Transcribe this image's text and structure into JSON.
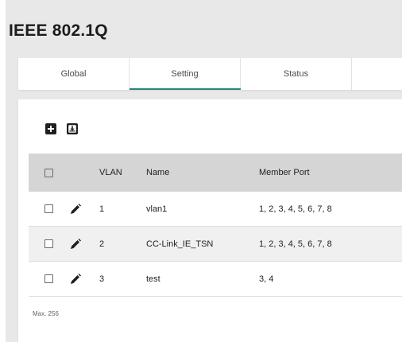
{
  "page": {
    "title": "IEEE 802.1Q"
  },
  "tabs": [
    {
      "label": "Global",
      "active": false
    },
    {
      "label": "Setting",
      "active": true
    },
    {
      "label": "Status",
      "active": false
    }
  ],
  "colors": {
    "accent": "#1b8a78",
    "header_bg": "#d5d5d5",
    "stripe_bg": "#f0f0f0",
    "page_bg": "#e8e8e8"
  },
  "toolbar": {
    "icons": [
      "add-icon",
      "import-icon"
    ]
  },
  "table": {
    "columns": [
      "VLAN",
      "Name",
      "Member Port"
    ],
    "rows": [
      {
        "vlan": "1",
        "name": "vlan1",
        "member_port": "1, 2, 3, 4, 5, 6, 7, 8"
      },
      {
        "vlan": "2",
        "name": "CC-Link_IE_TSN",
        "member_port": "1, 2, 3, 4, 5, 6, 7, 8"
      },
      {
        "vlan": "3",
        "name": "test",
        "member_port": "3, 4"
      }
    ],
    "footer_note": "Max. 256"
  }
}
